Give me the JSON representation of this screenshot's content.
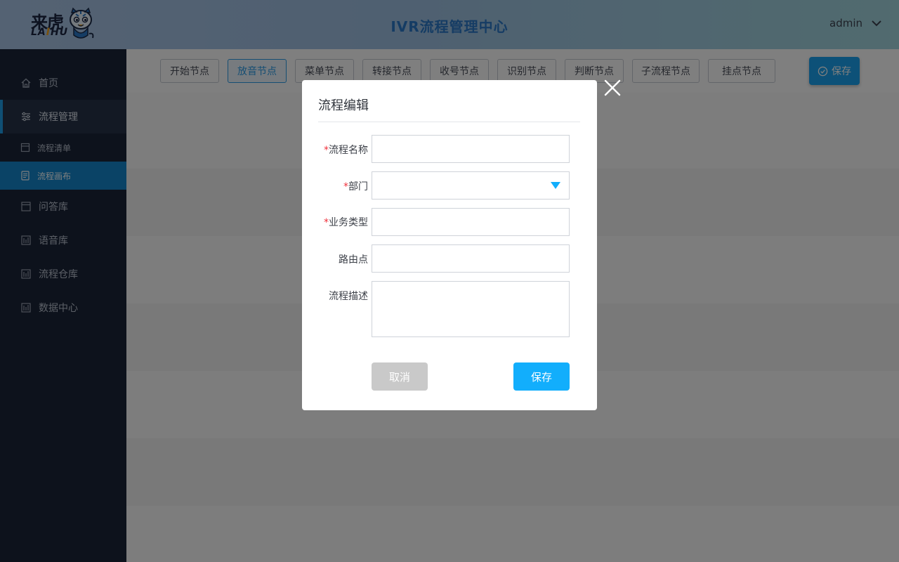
{
  "header": {
    "logo_cn": "来虎",
    "logo_en_prefix": "LA",
    "logo_en_i": "I",
    "logo_en_suffix": "HU",
    "title": "IVR流程管理中心",
    "user": "admin"
  },
  "sidebar": {
    "items": [
      {
        "label": "首页",
        "icon": "home-icon"
      },
      {
        "label": "流程管理",
        "icon": "sliders-icon"
      },
      {
        "label": "流程清单",
        "icon": "box-icon"
      },
      {
        "label": "流程画布",
        "icon": "document-icon"
      },
      {
        "label": "问答库",
        "icon": "box-icon"
      },
      {
        "label": "语音库",
        "icon": "bars-icon"
      },
      {
        "label": "流程仓库",
        "icon": "bars-icon"
      },
      {
        "label": "数据中心",
        "icon": "bars-icon"
      }
    ]
  },
  "toolbar": {
    "nodes": [
      "开始节点",
      "放音节点",
      "菜单节点",
      "转接节点",
      "收号节点",
      "识别节点",
      "判断节点",
      "子流程节点",
      "挂点节点"
    ],
    "save_label": "保存"
  },
  "modal": {
    "title": "流程编辑",
    "fields": [
      {
        "label": "流程名称",
        "required": true,
        "value": ""
      },
      {
        "label": "部门",
        "required": true,
        "value": ""
      },
      {
        "label": "业务类型",
        "required": true,
        "value": ""
      },
      {
        "label": "路由点",
        "required": false,
        "value": ""
      },
      {
        "label": "流程描述",
        "required": false,
        "value": ""
      }
    ],
    "required_mark": "*",
    "cancel_label": "取消",
    "save_label": "保存"
  },
  "colors": {
    "accent": "#12aefc",
    "sidebar_bg": "#1b2538",
    "sidebar_active": "#1487cc",
    "required": "#f0313c"
  }
}
